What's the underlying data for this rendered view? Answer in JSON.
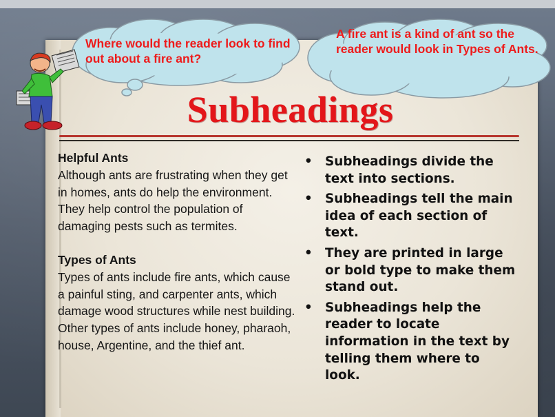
{
  "slide": {
    "title": "Subheadings",
    "title_color": "#e3161a"
  },
  "callouts": {
    "left_question": "Where would the reader look to find out about a fire ant?",
    "right_answer": "A fire ant is a kind of ant so the reader would look in Types of Ants.",
    "text_color": "#ee1b1b",
    "cloud_fill": "#bfe3ec"
  },
  "left_column": {
    "sections": [
      {
        "subheading": "Helpful Ants",
        "body": "Although ants are frustrating when they get in homes, ants do help the environment. They help control the population of damaging pests such as termites."
      },
      {
        "subheading": "Types of Ants",
        "body": "Types of ants include fire ants, which cause a painful sting, and carpenter ants, which damage wood structures while nest building. Other types of ants include honey, pharaoh, house, Argentine, and the thief ant."
      }
    ]
  },
  "right_column": {
    "bullet_symbol": "•",
    "bullets": [
      "Subheadings divide the text into sections.",
      "Subheadings tell the main idea of each section of text.",
      "They are printed in large or bold type to make them stand out.",
      "Subheadings help the reader to locate information in the text by telling them where to look."
    ]
  },
  "decorations": {
    "clipart": "worker-holding-blueprints-icon",
    "divider_color": "#b7352d"
  }
}
